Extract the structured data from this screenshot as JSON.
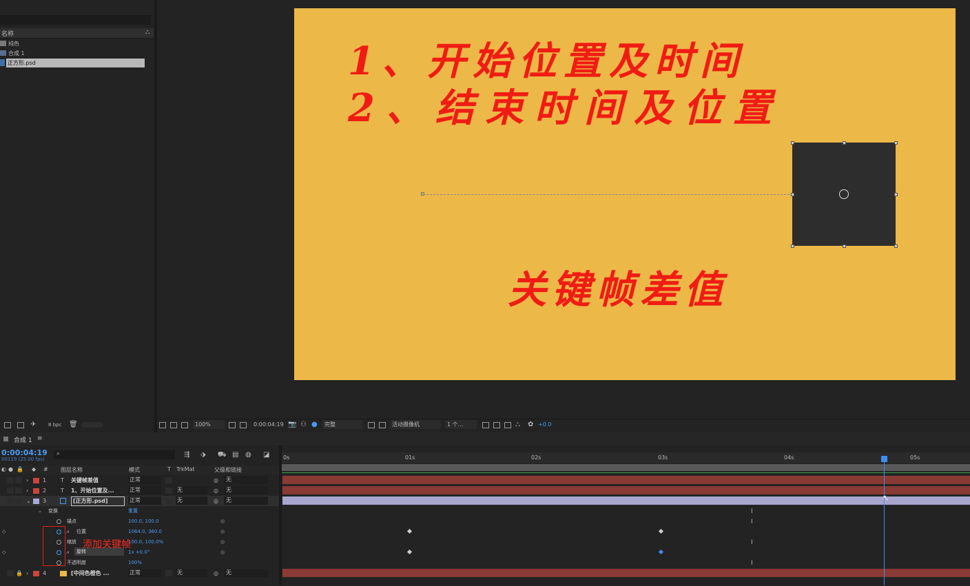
{
  "project": {
    "column_name": "名称",
    "items": [
      {
        "label": "纯色",
        "icon": "folder-icon"
      },
      {
        "label": "合成 1",
        "icon": "composition-icon"
      },
      {
        "label": "正方形.psd",
        "icon": "psd-file-icon"
      }
    ],
    "bpc": "8 bpc"
  },
  "composition": {
    "line1": "1、开始位置及时间",
    "line2": "2、结束时间及位置",
    "line3": "关键帧差值",
    "background": "#ecb848",
    "text_color": "#f01c14",
    "square_color": "#2d2d2d"
  },
  "viewer_toolbar": {
    "zoom": "100%",
    "timecode": "0:00:04:19",
    "resolution": "完整",
    "camera": "活动摄像机",
    "views": "1 个...",
    "exposure": "+0.0"
  },
  "timeline": {
    "comp_tab": "合成 1",
    "timecode": "0:00:04:19",
    "fps_info": "00119 (25.00 fps)",
    "columns": {
      "layer_name": "图层名称",
      "mode": "模式",
      "t": "T",
      "trkmat": "TrkMat",
      "parent": "父级和链接",
      "number": "#"
    },
    "layers": [
      {
        "num": "1",
        "type": "T",
        "name": "关键帧差值",
        "mode": "正常",
        "trkmat": "",
        "parent": "无",
        "color": "#c9463d"
      },
      {
        "num": "2",
        "type": "T",
        "name": "1、开始位置及...",
        "mode": "正常",
        "trkmat": "无",
        "parent": "无",
        "color": "#c9463d"
      },
      {
        "num": "3",
        "type": "",
        "name": "[正方形.psd]",
        "mode": "正常",
        "trkmat": "无",
        "parent": "无",
        "color": "#a9a9d8"
      },
      {
        "num": "4",
        "type": "",
        "name": "[中间色橙色 ...",
        "mode": "正常",
        "trkmat": "无",
        "parent": "无",
        "color": "#c9463d"
      }
    ],
    "transform_label": "变换",
    "reset_label": "重置",
    "properties": [
      {
        "name": "锚点",
        "value": "100.0, 100.0"
      },
      {
        "name": "位置",
        "value": "1064.0, 360.0"
      },
      {
        "name": "缩放",
        "value": "100.0, 100.0%"
      },
      {
        "name": "旋转",
        "value": "1x +0.0°"
      },
      {
        "name": "不透明度",
        "value": "100%"
      }
    ],
    "ruler_ticks": [
      "0s",
      "01s",
      "02s",
      "03s",
      "04s",
      "05s"
    ],
    "annotation": "添加关键帧",
    "tooltip": "旋转"
  }
}
